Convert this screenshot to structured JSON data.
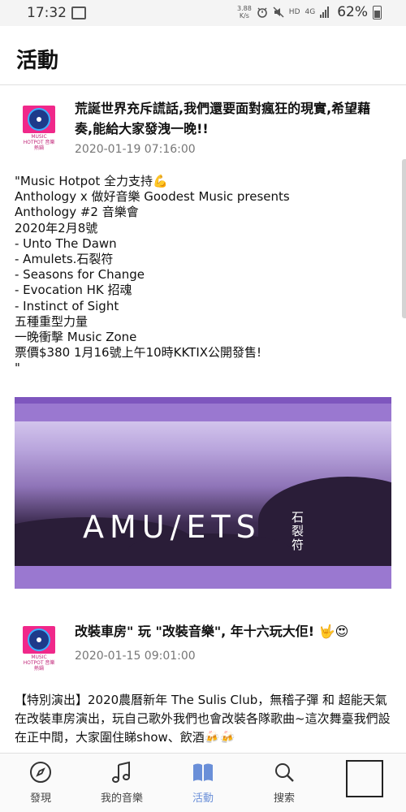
{
  "status_bar": {
    "time": "17:32",
    "net_speed_value": "3.88",
    "net_speed_unit": "K/s",
    "hd_label": "HD",
    "lte_label": "4G",
    "battery": "62%"
  },
  "header": {
    "title": "活動"
  },
  "posts": [
    {
      "logo_text": "MUSIC HOTPOT 音樂熱鍋",
      "title": "荒誕世界充斥謊話,我們還要面對瘋狂的現實,希望藉奏,能給大家發洩一晚!!",
      "date": "2020-01-19 07:16:00",
      "body": "\"Music Hotpot 全力支持💪\nAnthology x 做好音樂 Goodest Music presents\nAnthology #2 音樂會\n2020年2月8號\n- Unto The Dawn\n- Amulets.石裂符\n- Seasons for Change\n- Evocation HK 招魂\n- Instinct of Sight\n五種重型力量\n一晚衝擊 Music Zone\n票價$380 1月16號上午10時KKTIX公開發售!\n\"",
      "image_text": "AMU/ETS",
      "image_cn_text": "石裂符"
    },
    {
      "logo_text": "MUSIC HOTPOT 音樂熱鍋",
      "title": "改裝車房\" 玩 \"改裝音樂\", 年十六玩大佢! 🤟😍",
      "date": "2020-01-15 09:01:00",
      "body": "【特別演出】2020農曆新年 The Sulis Club，無稽子彈 和 超能天氣 在改裝車房演出，玩自己歌外我們也會改裝各隊歌曲~這次舞臺我們設在正中間，大家圍住睇show、飲酒🍻🍻"
    }
  ],
  "nav": {
    "items": [
      {
        "label": "發現",
        "icon": "compass-icon"
      },
      {
        "label": "我的音樂",
        "icon": "music-note-icon"
      },
      {
        "label": "活動",
        "icon": "book-icon"
      },
      {
        "label": "搜索",
        "icon": "search-icon"
      }
    ],
    "active_color": "#6a8fd8"
  },
  "colors": {
    "accent_purple": "#9a78d0",
    "logo_pink": "#f0288a"
  }
}
